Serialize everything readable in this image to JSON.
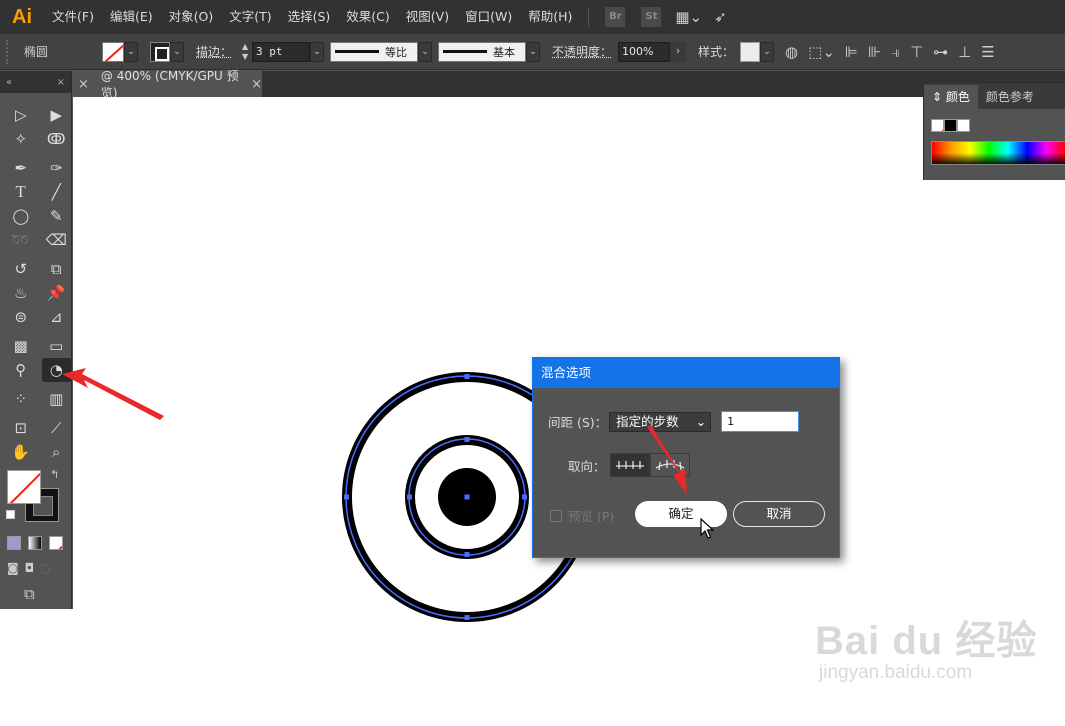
{
  "app": {
    "logo": "Ai",
    "menu": [
      "文件(F)",
      "编辑(E)",
      "对象(O)",
      "文字(T)",
      "选择(S)",
      "效果(C)",
      "视图(V)",
      "窗口(W)",
      "帮助(H)"
    ],
    "bridge_label": "Br",
    "stock_label": "St"
  },
  "control_bar": {
    "shape_name": "椭圆",
    "stroke_label": "描边：",
    "stroke_value": "3 pt",
    "profile_label": "等比",
    "brush_label": "基本",
    "opacity_label": "不透明度：",
    "opacity_value": "100%",
    "style_label": "样式："
  },
  "document": {
    "tab_title": "@ 400% (CMYK/GPU 预览)",
    "close_glyph": "×"
  },
  "color_panel": {
    "tabs": [
      "颜色",
      "颜色参考"
    ],
    "active_tab": 0
  },
  "dialog": {
    "title": "混合选项",
    "spacing_label": "间距 (S)：",
    "spacing_option": "指定的步数",
    "steps_value": "1",
    "orientation_label": "取向：",
    "preview_label": "预览 (P)",
    "preview_checked": false,
    "ok_label": "确定",
    "cancel_label": "取消"
  },
  "colors": {
    "accent": "#1473e6",
    "annotation_arrow": "#e8282b",
    "selection": "#4b6bff"
  },
  "watermark": {
    "main": "Bai du 经验",
    "sub": "jingyan.baidu.com"
  }
}
